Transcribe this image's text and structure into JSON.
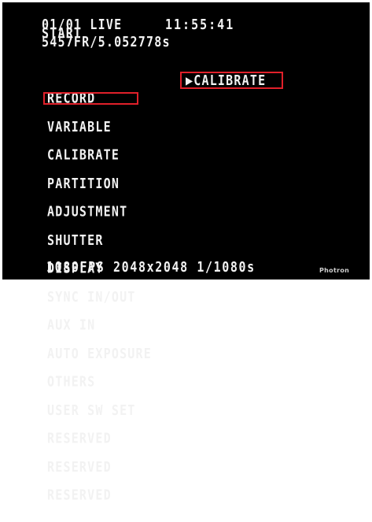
{
  "status": {
    "mode_line": "01/01 LIVE",
    "clock": "11:55:41",
    "state": "START",
    "frames": "5457FR/5.052778s"
  },
  "menu": {
    "items": [
      {
        "label": "RECORD"
      },
      {
        "label": "VARIABLE"
      },
      {
        "label": "CALIBRATE"
      },
      {
        "label": "PARTITION"
      },
      {
        "label": "ADJUSTMENT"
      },
      {
        "label": "SHUTTER"
      },
      {
        "label": "DISPLAY"
      },
      {
        "label": "SYNC IN/OUT"
      },
      {
        "label": "AUX IN"
      },
      {
        "label": "AUTO EXPOSURE"
      },
      {
        "label": "OTHERS"
      },
      {
        "label": "USER SW SET"
      },
      {
        "label": "RESERVED"
      },
      {
        "label": "RESERVED"
      },
      {
        "label": "RESERVED"
      }
    ],
    "selected_index": 2
  },
  "submenu": {
    "label": "▶CALIBRATE"
  },
  "footer": {
    "info": "1080FPS 2048x2048 1/1080s",
    "brand": "Photron"
  },
  "colors": {
    "background": "#000000",
    "text": "#f2f2f2",
    "highlight": "#e0202a"
  }
}
